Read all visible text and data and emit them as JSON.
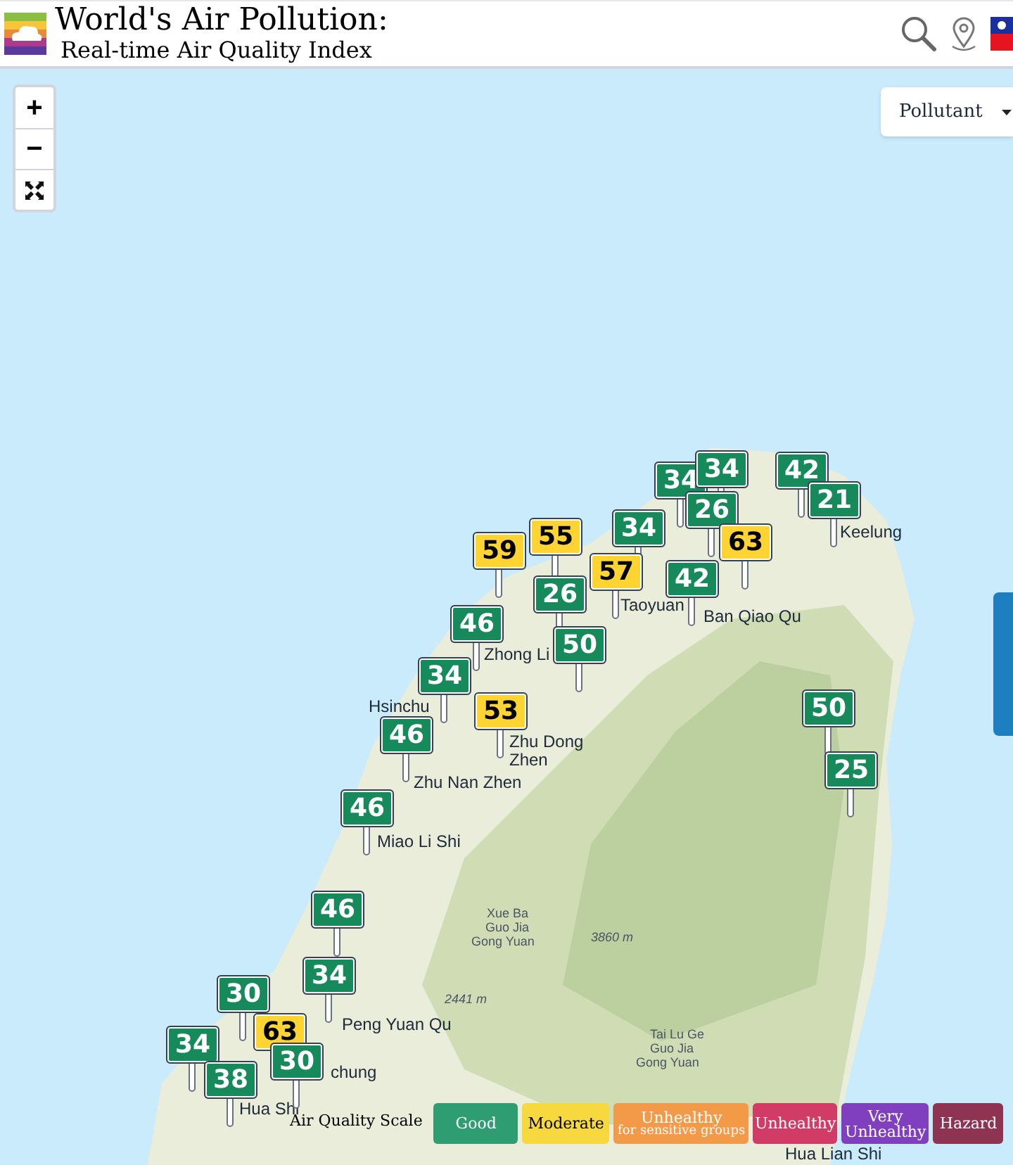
{
  "header": {
    "title": "World's Air Pollution:",
    "subtitle": "Real-time Air Quality Index"
  },
  "zoom_controls": [
    {
      "kind": "zoom_in",
      "label": "+"
    },
    {
      "kind": "zoom_out",
      "label": "−"
    },
    {
      "kind": "fullscreen"
    }
  ],
  "pollutant_menu": {
    "label": "Pollutant"
  },
  "places": [
    {
      "name": "Keelung"
    },
    {
      "name": "Taoyuan"
    },
    {
      "name": "Ban Qiao Qu"
    },
    {
      "name": "Zhong Li"
    },
    {
      "name": "Hsinchu"
    },
    {
      "name": "Zhu Dong"
    },
    {
      "name": "Zhen"
    },
    {
      "name": "Zhu Nan Zhen"
    },
    {
      "name": "Miao Li Shi"
    },
    {
      "name": "Xue Ba"
    },
    {
      "name": "Guo Jia"
    },
    {
      "name": "Gong Yuan"
    },
    {
      "name": "3860 m"
    },
    {
      "name": "2441 m"
    },
    {
      "name": "Peng Yuan Qu"
    },
    {
      "name": "chung"
    },
    {
      "name": "Hua Shi"
    },
    {
      "name": "Tai Lu Ge"
    },
    {
      "name": "Guo Jia"
    },
    {
      "name": "Gong Yuan"
    },
    {
      "name": "Hua Lian Shi"
    }
  ],
  "markers": [
    {
      "value": "34",
      "kind": "good"
    },
    {
      "value": "34",
      "kind": "good"
    },
    {
      "value": "42",
      "kind": "good"
    },
    {
      "value": "21",
      "kind": "good"
    },
    {
      "value": "26",
      "kind": "good"
    },
    {
      "value": "34",
      "kind": "good"
    },
    {
      "value": "42",
      "kind": "good"
    },
    {
      "value": "63",
      "kind": "moderate"
    },
    {
      "value": "59",
      "kind": "moderate"
    },
    {
      "value": "55",
      "kind": "moderate"
    },
    {
      "value": "57",
      "kind": "moderate"
    },
    {
      "value": "26",
      "kind": "good"
    },
    {
      "value": "46",
      "kind": "good"
    },
    {
      "value": "50",
      "kind": "good"
    },
    {
      "value": "34",
      "kind": "good"
    },
    {
      "value": "53",
      "kind": "moderate"
    },
    {
      "value": "46",
      "kind": "good"
    },
    {
      "value": "50",
      "kind": "good"
    },
    {
      "value": "25",
      "kind": "good"
    },
    {
      "value": "46",
      "kind": "good"
    },
    {
      "value": "46",
      "kind": "good"
    },
    {
      "value": "34",
      "kind": "good"
    },
    {
      "value": "30",
      "kind": "good"
    },
    {
      "value": "34",
      "kind": "good"
    },
    {
      "value": "63",
      "kind": "moderate"
    },
    {
      "value": "30",
      "kind": "good"
    },
    {
      "value": "38",
      "kind": "good"
    }
  ],
  "legend": {
    "title": "Air Quality Scale",
    "items": [
      {
        "label": "Good",
        "color": "#2e9e72"
      },
      {
        "label": "Moderate",
        "color": "#f7d83f"
      },
      {
        "label": "Unhealthy",
        "note": "for sensitive groups",
        "color": "#f29a48"
      },
      {
        "label": "Unhealthy",
        "color": "#d13c66"
      },
      {
        "label": "Very Unhealthy",
        "color": "#7f3fbf"
      },
      {
        "label": "Hazard",
        "color": "#8e3452"
      }
    ]
  }
}
